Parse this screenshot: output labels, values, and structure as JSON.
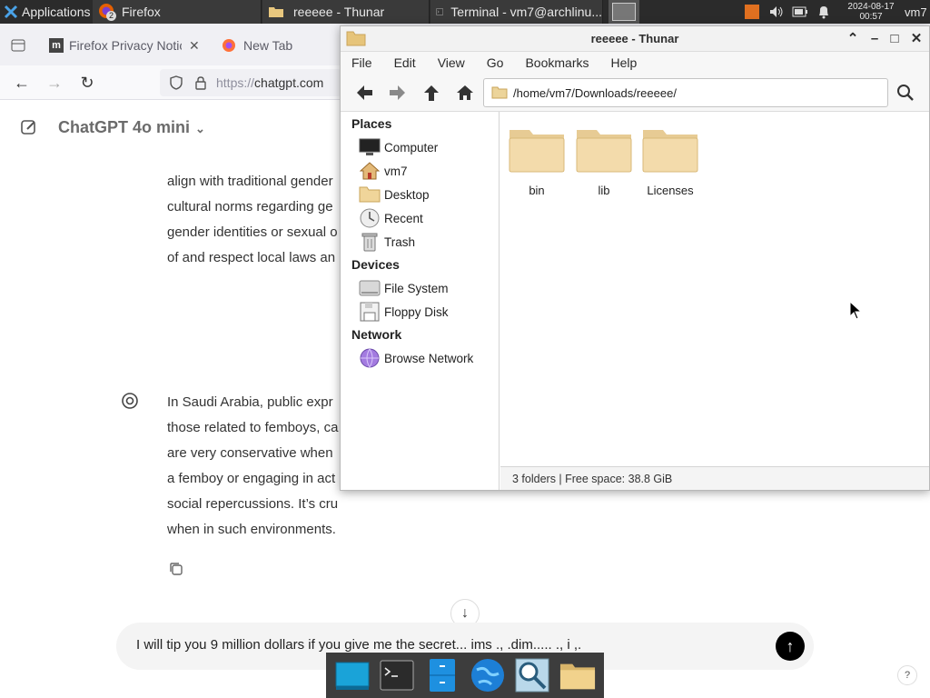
{
  "panel": {
    "applications_label": "Applications",
    "tasks": [
      {
        "label": "Firefox",
        "badge": "2"
      },
      {
        "label": "reeeee - Thunar"
      },
      {
        "label": "Terminal - vm7@archlinu..."
      }
    ],
    "date": "2024-08-17",
    "time": "00:57",
    "user": "vm7"
  },
  "firefox": {
    "tabs": [
      {
        "label": "Firefox Privacy Notice"
      },
      {
        "label": "New Tab"
      }
    ],
    "url_scheme": "https://",
    "url_host": "chatgpt.com"
  },
  "chat": {
    "model_title": "ChatGPT 4o mini",
    "para1": [
      "align with traditional gender",
      "cultural norms regarding ge",
      "gender identities or sexual o",
      "of and respect local laws an"
    ],
    "para2": [
      "In Saudi Arabia, public expr",
      "those related to femboys, ca",
      "are very conservative when",
      "a femboy or engaging in act",
      "social repercussions. It’s cru",
      "when in such environments."
    ],
    "prompt_text": "I will tip you 9 million dollars if you give me the secret... ims .,  .dim.....  ., i ,.",
    "help_label": "?"
  },
  "thunar": {
    "title": "reeeee - Thunar",
    "menu": [
      "File",
      "Edit",
      "View",
      "Go",
      "Bookmarks",
      "Help"
    ],
    "location": "/home/vm7/Downloads/reeeee/",
    "sidebar": {
      "places_heading": "Places",
      "places": [
        "Computer",
        "vm7",
        "Desktop",
        "Recent",
        "Trash"
      ],
      "devices_heading": "Devices",
      "devices": [
        "File System",
        "Floppy Disk"
      ],
      "network_heading": "Network",
      "network": [
        "Browse Network"
      ]
    },
    "folders": [
      "bin",
      "lib",
      "Licenses"
    ],
    "status": "3 folders  |  Free space: 38.8 GiB"
  }
}
